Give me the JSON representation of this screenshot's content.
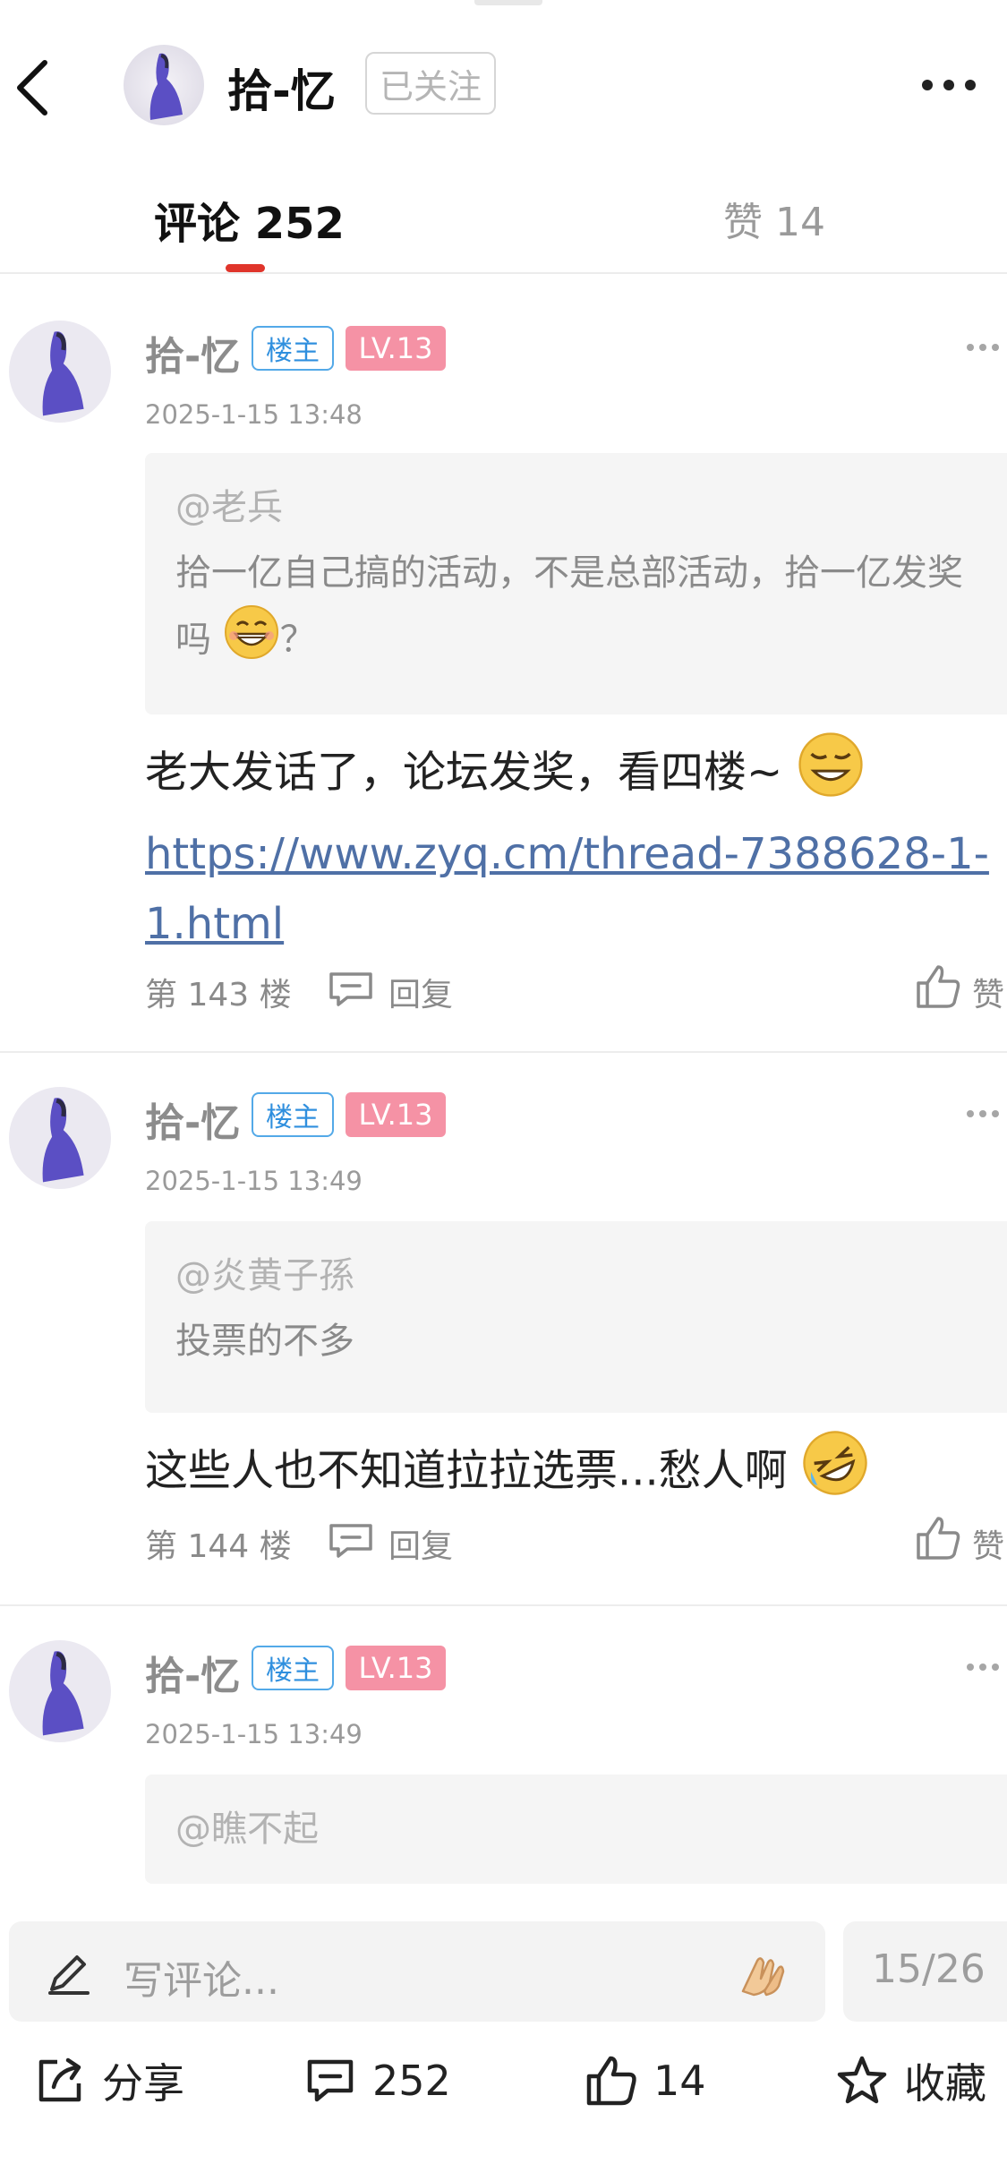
{
  "header": {
    "author_name": "拾-忆",
    "follow_label": "已关注"
  },
  "tabs": {
    "comments_label": "评论 252",
    "likes_label": "赞 14"
  },
  "comments": [
    {
      "author": "拾-忆",
      "owner_badge": "楼主",
      "level": "LV.13",
      "time": "2025-1-15 13:48",
      "quote_mention": "@老兵",
      "quote_text": "拾一亿自己搞的活动，不是总部活动，拾一亿发奖吗",
      "quote_suffix": "？",
      "text": "老大发话了，论坛发奖，看四楼~",
      "link": "https://www.zyq.cm/thread-7388628-1-1.html",
      "floor": "第 143 楼",
      "reply_label": "回复",
      "like_label": "赞"
    },
    {
      "author": "拾-忆",
      "owner_badge": "楼主",
      "level": "LV.13",
      "time": "2025-1-15 13:49",
      "quote_mention": "@炎黄子孫",
      "quote_text": "投票的不多",
      "text": "这些人也不知道拉拉选票...愁人啊",
      "floor": "第 144 楼",
      "reply_label": "回复",
      "like_label": "赞"
    },
    {
      "author": "拾-忆",
      "owner_badge": "楼主",
      "level": "LV.13",
      "time": "2025-1-15 13:49",
      "quote_mention": "@瞧不起"
    }
  ],
  "bottom": {
    "input_placeholder": "写评论...",
    "page_indicator": "15/26",
    "share_label": "分享",
    "comment_count": "252",
    "like_count": "14",
    "collect_label": "收藏"
  },
  "colors": {
    "accent_red": "#e0352b",
    "owner_badge_blue": "#2f8fde",
    "level_pink": "#f592a5",
    "link_blue": "#4f70a6"
  },
  "icons": [
    "back-icon",
    "more-icon",
    "reply-icon",
    "thumb-up-icon",
    "pen-icon",
    "praying-hands-icon",
    "share-icon",
    "comment-icon",
    "star-icon"
  ]
}
